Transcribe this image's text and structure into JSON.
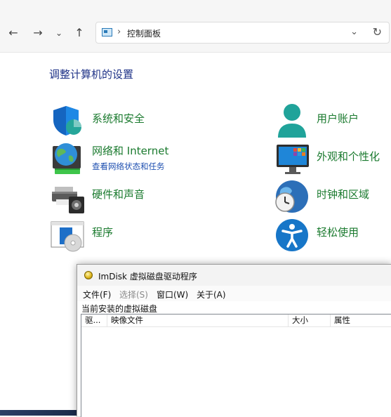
{
  "address_bar": {
    "back_icon": "arrow-left-icon",
    "forward_icon": "arrow-right-icon",
    "recent_icon": "chevron-down-icon",
    "up_icon": "arrow-up-icon",
    "breadcrumb": "控制面板",
    "refresh_icon": "refresh-icon"
  },
  "control_panel": {
    "heading": "调整计算机的设置",
    "categories": [
      {
        "label": "系统和安全",
        "icon": "shield-icon"
      },
      {
        "label": "网络和 Internet",
        "sub": "查看网络状态和任务",
        "icon": "globe-network-icon"
      },
      {
        "label": "硬件和声音",
        "icon": "printer-speaker-icon"
      },
      {
        "label": "程序",
        "icon": "programs-icon"
      },
      {
        "label": "用户账户",
        "icon": "user-icon"
      },
      {
        "label": "外观和个性化",
        "icon": "monitor-icon"
      },
      {
        "label": "时钟和区域",
        "icon": "clock-globe-icon"
      },
      {
        "label": "轻松使用",
        "icon": "accessibility-icon"
      }
    ]
  },
  "imdisk": {
    "title": "ImDisk 虚拟磁盘驱动程序",
    "menus": [
      "文件(F)",
      "选择(S)",
      "窗口(W)",
      "关于(A)"
    ],
    "caption": "当前安装的虚拟磁盘",
    "columns": [
      "驱...",
      "映像文件",
      "大小",
      "属性"
    ]
  },
  "colors": {
    "link_green": "#1a7a2e",
    "heading_blue": "#1e3287",
    "sub_link_blue": "#1e4fb0"
  }
}
